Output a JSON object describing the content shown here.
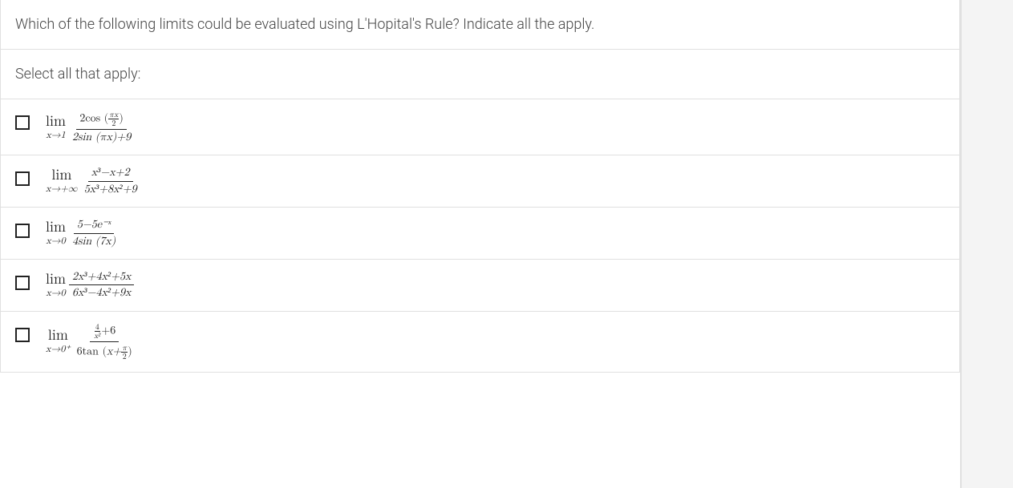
{
  "question": "Which of the following limits could be evaluated using L'Hopital's Rule? Indicate all the apply.",
  "instruction": "Select all that apply:",
  "options": {
    "o1": {
      "lim_sub": "x→1",
      "num_prefix": "2cos",
      "num_inner_top": "πx",
      "num_inner_bot": "2",
      "den": "2sin (πx)+9"
    },
    "o2": {
      "lim_sub": "x→+∞",
      "num": "x³−x+2",
      "den": "5x³+8x²+9"
    },
    "o3": {
      "lim_sub": "x→0",
      "num": "5−5e⁻ˣ",
      "den": "4sin (7x)"
    },
    "o4": {
      "lim_sub": "x→0",
      "num": "2x³+4x²+5x",
      "den": "6x³−4x²+9x"
    },
    "o5": {
      "lim_sub": "x→0⁺",
      "num_top_a": "4",
      "num_top_b": "x²",
      "num_suffix": "+6",
      "den_prefix": "6tan",
      "den_inner_a": "x+",
      "den_inner_top": "π",
      "den_inner_bot": "2"
    }
  }
}
